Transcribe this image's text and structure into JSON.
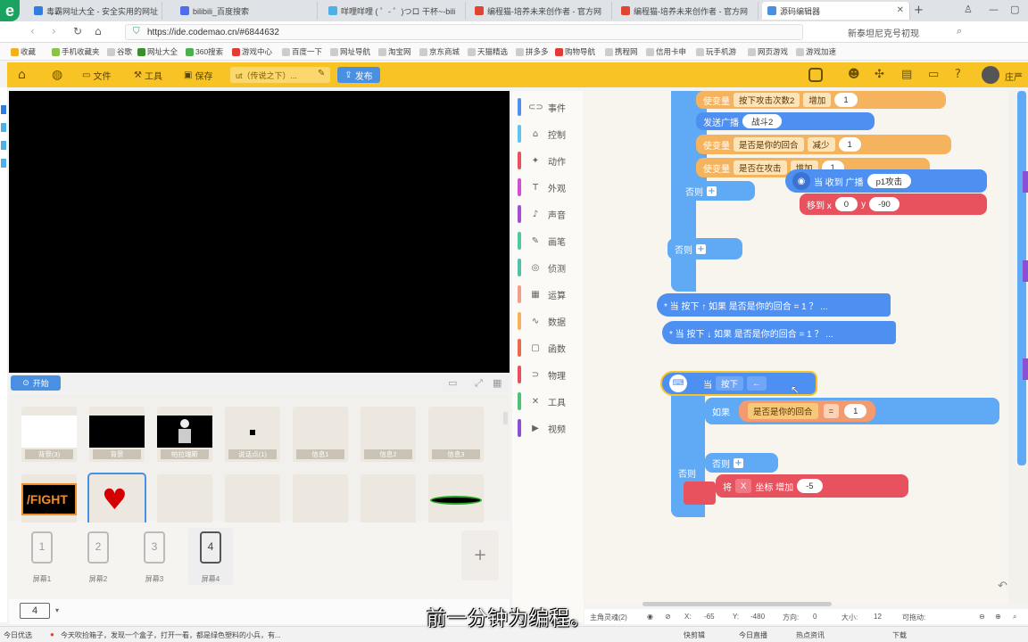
{
  "browser": {
    "tabs": [
      {
        "title": "毒霸网址大全 - 安全实用的网址",
        "color": "#2f7de1"
      },
      {
        "title": "bilibili_百度搜索",
        "color": "#4e6ef2"
      },
      {
        "title": "咩哩咩哩 ( ゜- ゜)つロ 干杯~-bili",
        "color": "#4fb0e6"
      },
      {
        "title": "编程猫-培养未来创作者 - 官方网",
        "color": "#e0462f"
      },
      {
        "title": "编程猫-培养未来创作者 - 官方网",
        "color": "#e0462f"
      },
      {
        "title": "源码编辑器",
        "color": "#4a90e2",
        "active": true
      }
    ],
    "url": "https://ide.codemao.cn/#6844632",
    "search_text": "新泰坦尼克号初现",
    "bookmarks": [
      "收藏",
      "手机收藏夹",
      "谷歌",
      "网址大全",
      "360搜索",
      "游戏中心",
      "百度一下",
      "网址导航",
      "淘宝网",
      "京东商城",
      "天猫精选",
      "拼多多",
      "购物导航",
      "携程网",
      "信用卡申",
      "玩手机游",
      "网页游戏",
      "游戏加速"
    ]
  },
  "toolbar": {
    "file": "文件",
    "tools": "工具",
    "save": "保存",
    "project_title": "ut（传说之下）...",
    "publish": "发布",
    "user": "庄严"
  },
  "stage": {
    "start": "开始"
  },
  "sprites": [
    {
      "name": "背景(3)",
      "thumb": "white"
    },
    {
      "name": "背景",
      "thumb": "black"
    },
    {
      "name": "帕拉瑞斯",
      "thumb": "skeleton"
    },
    {
      "name": "说话点(1)",
      "thumb": "dot"
    },
    {
      "name": "信息1",
      "thumb": "blank"
    },
    {
      "name": "信息2",
      "thumb": "blank"
    },
    {
      "name": "信息3",
      "thumb": "blank"
    },
    {
      "name": "",
      "thumb": "fight"
    },
    {
      "name": "",
      "thumb": "heart"
    },
    {
      "name": "",
      "thumb": "blank"
    },
    {
      "name": "",
      "thumb": "blank"
    },
    {
      "name": "",
      "thumb": "blank"
    },
    {
      "name": "",
      "thumb": "blank"
    },
    {
      "name": "",
      "thumb": "bar"
    }
  ],
  "fight_text": "/FIGHT",
  "screens": [
    {
      "num": "1",
      "label": "屏幕1"
    },
    {
      "num": "2",
      "label": "屏幕2"
    },
    {
      "num": "3",
      "label": "屏幕3"
    },
    {
      "num": "4",
      "label": "屏幕4",
      "selected": true
    }
  ],
  "screen_select": "4",
  "categories": [
    {
      "label": "事件",
      "color": "#4e8ff2",
      "icon": "⊂⊃"
    },
    {
      "label": "控制",
      "color": "#5fc3f0",
      "icon": "⌂"
    },
    {
      "label": "动作",
      "color": "#e8515e",
      "icon": "✦"
    },
    {
      "label": "外观",
      "color": "#d24fd2",
      "icon": "T"
    },
    {
      "label": "声音",
      "color": "#a24fd2",
      "icon": "♪"
    },
    {
      "label": "画笔",
      "color": "#4fc9a2",
      "icon": "✎"
    },
    {
      "label": "侦测",
      "color": "#4fc2a8",
      "icon": "◎"
    },
    {
      "label": "运算",
      "color": "#f0a08a",
      "icon": "▦"
    },
    {
      "label": "数据",
      "color": "#f4b35c",
      "icon": "∿"
    },
    {
      "label": "函数",
      "color": "#e86a4f",
      "icon": "▢"
    },
    {
      "label": "物理",
      "color": "#e8515e",
      "icon": "⊃"
    },
    {
      "label": "工具",
      "color": "#4fc27a",
      "icon": "✕"
    },
    {
      "label": "视频",
      "color": "#8a4fd2",
      "icon": "▶"
    }
  ],
  "blocks": {
    "set_var": "使变量",
    "press_attack_count": "按下攻击次数2",
    "increase": "增加",
    "one": "1",
    "send_broadcast": "发送广播",
    "battle2": "战斗2",
    "is_your_turn": "是否是你的回合",
    "decrease": "减少",
    "is_at": "是否在攻击",
    "else": "否则",
    "when_receive": "当 收到 广播",
    "p1attack": "p1攻击",
    "move_to_x": "移到 x",
    "x_val": "0",
    "y_label": "y",
    "y_val": "-90",
    "comment1": "* 当 按下 ↑ 如果 是否是你的回合 = 1 ？ ...",
    "comment2": "* 当 按下 ↓ 如果 是否是你的回合 = 1 ？ ...",
    "when": "当",
    "pressed": "按下",
    "left_arrow": "←",
    "if": "如果",
    "equals": "=",
    "set": "将",
    "x_axis": "X",
    "coord_increase": "坐标 增加",
    "minus5": "-5"
  },
  "status": {
    "sprite": "主角灵魂(2)",
    "x_label": "X:",
    "x": "-65",
    "y_label": "Y:",
    "y": "-480",
    "dir_label": "方向:",
    "dir": "0",
    "size_label": "大小:",
    "size": "12",
    "drag_label": "可拖动:"
  },
  "taskbar": {
    "left1": "今日优选",
    "news": "今天吹捡箱子，发现一个盒子，打开一看，都是绿色塑料的小兵，有...",
    "items": [
      "快剪辑",
      "今日直播",
      "热点资讯",
      "下载"
    ]
  },
  "caption": "前一分钟为编程。"
}
